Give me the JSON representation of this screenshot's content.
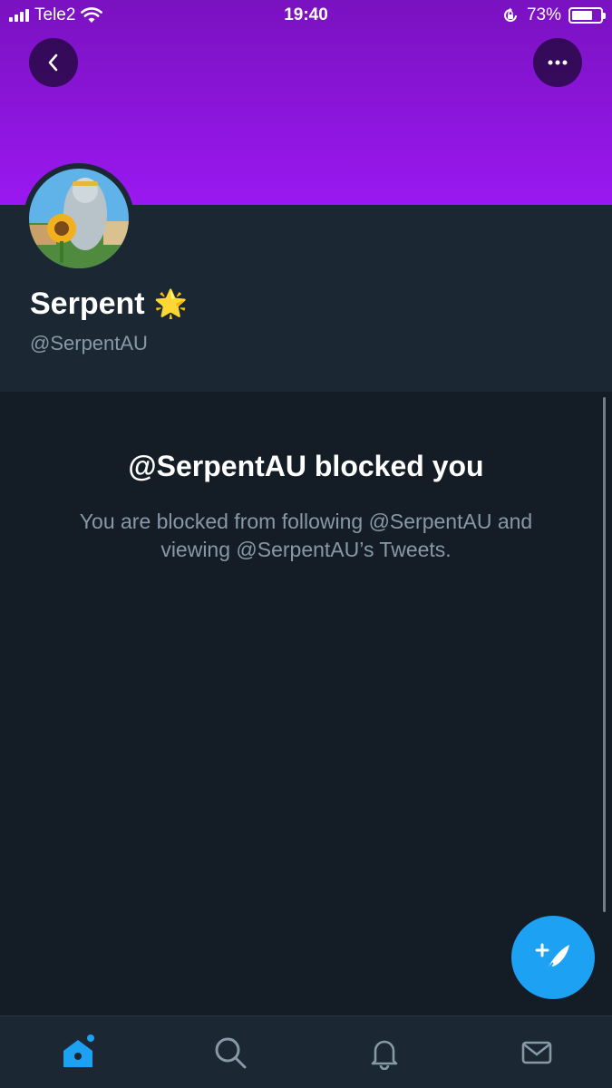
{
  "status_bar": {
    "carrier": "Tele2",
    "time": "19:40",
    "battery_percent": "73%",
    "battery_level": 0.73
  },
  "header": {
    "back_icon": "chevron-left-icon",
    "more_icon": "ellipsis-icon",
    "banner_color": "#8f16e0"
  },
  "profile": {
    "name": "Serpent",
    "name_emoji": "🌟",
    "handle": "@SerpentAU"
  },
  "blocked": {
    "title": "@SerpentAU blocked you",
    "message": "You are blocked from following @SerpentAU and viewing @SerpentAU’s Tweets."
  },
  "fab": {
    "icon": "compose-tweet-icon"
  },
  "tabbar": {
    "items": [
      {
        "name": "home",
        "icon": "home-icon",
        "active": true
      },
      {
        "name": "search",
        "icon": "search-icon",
        "active": false
      },
      {
        "name": "notifications",
        "icon": "bell-icon",
        "active": false
      },
      {
        "name": "messages",
        "icon": "mail-icon",
        "active": false
      }
    ],
    "active_color": "#1da1f2",
    "inactive_color": "#8899a6"
  }
}
